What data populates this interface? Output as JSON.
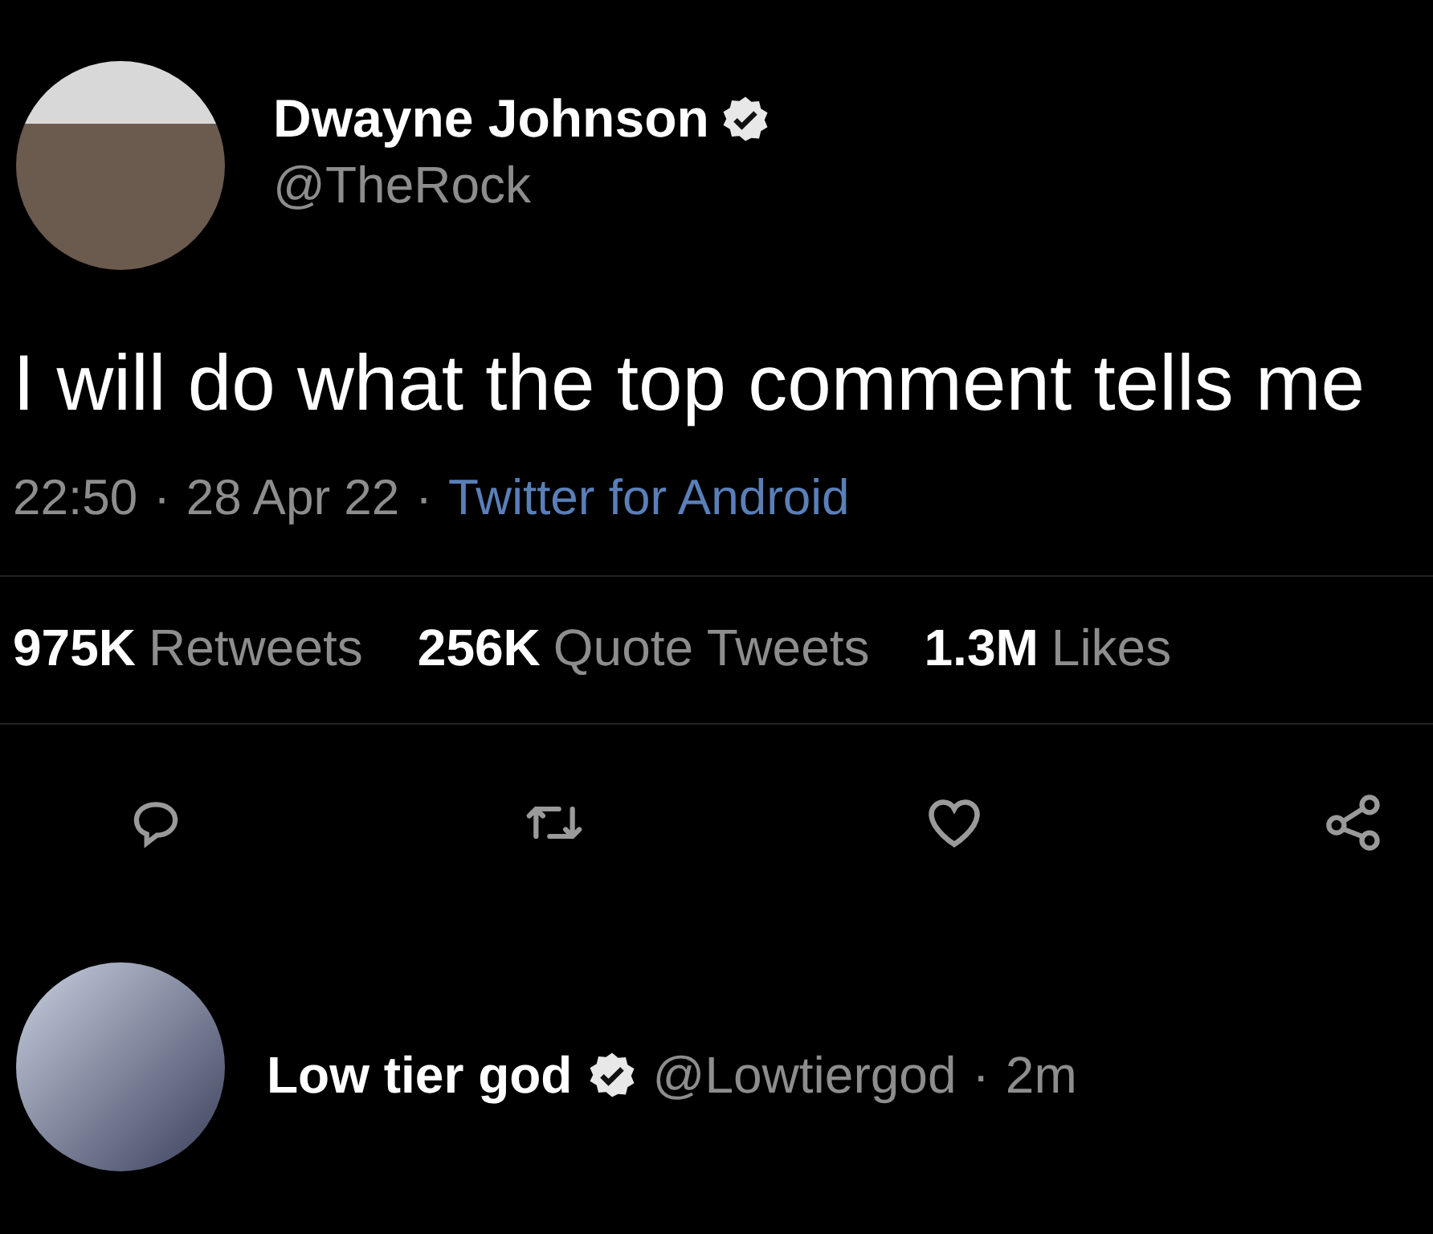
{
  "tweet": {
    "author": {
      "name": "Dwayne Johnson",
      "verified": true,
      "handle": "@TheRock"
    },
    "text": "I will do what the top comment tells me",
    "meta": {
      "time": "22:50",
      "separator": "·",
      "date": "28 Apr 22",
      "source": "Twitter for Android"
    },
    "stats": [
      {
        "count": "975K",
        "label": "Retweets"
      },
      {
        "count": "256K",
        "label": "Quote Tweets"
      },
      {
        "count": "1.3M",
        "label": "Likes"
      }
    ],
    "actions": [
      {
        "kind": "reply"
      },
      {
        "kind": "retweet"
      },
      {
        "kind": "like"
      },
      {
        "kind": "share"
      }
    ]
  },
  "reply": {
    "name": "Low tier god",
    "verified": true,
    "handle": "@Lowtiergod",
    "separator": "·",
    "time": "2m"
  }
}
